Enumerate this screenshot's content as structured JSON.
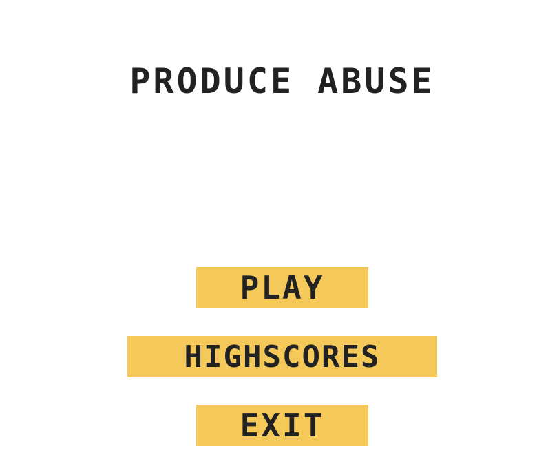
{
  "game": {
    "title": "PRODUCE ABUSE"
  },
  "menu": {
    "play_label": "PLAY",
    "highscores_label": "HIGHSCORES",
    "exit_label": "EXIT"
  },
  "colors": {
    "background": "#ffffff",
    "button": "#f5c85a",
    "text": "#222222"
  }
}
